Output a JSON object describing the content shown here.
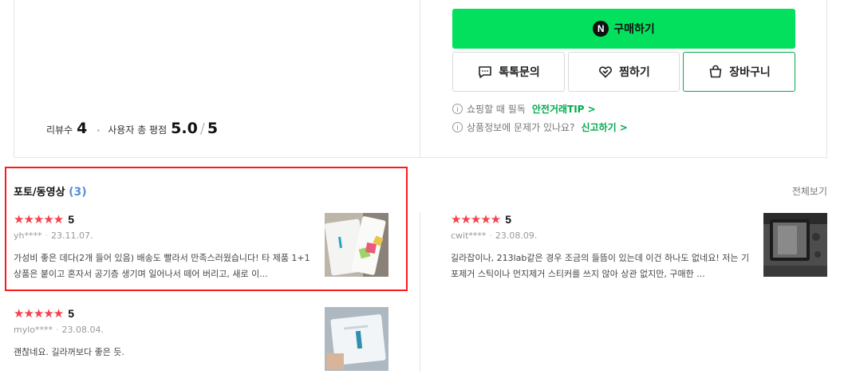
{
  "summary": {
    "review_count_label": "리뷰수",
    "review_count": "4",
    "avg_label": "사용자 총 평점",
    "avg_score": "5.0",
    "max_score": "5"
  },
  "actions": {
    "buy_label": "구매하기",
    "buy_badge": "N",
    "talk_label": "톡톡문의",
    "wish_label": "찜하기",
    "cart_label": "장바구니",
    "buy_color": "#03e05d"
  },
  "info": {
    "line1_text": "쇼핑할 때 필독",
    "line1_link": "안전거래TIP >",
    "line2_text": "상품정보에 문제가 있나요?",
    "line2_link": "신고하기 >",
    "icon": "i"
  },
  "reviews_section": {
    "title": "포토/동영상",
    "count": "(3)",
    "view_all": "전체보기"
  },
  "reviews": [
    {
      "stars": "★★★★★",
      "score": "5",
      "user": "yh****",
      "date": "23.11.07.",
      "text": "가성비 좋은 데다(2개 들어 있음) 배송도 빨라서 만족스러웠습니다! 타 제품 1+1 상품은 붙이고 혼자서 공기층 생기며 일어나서 떼어 버리고, 새로 이..."
    },
    {
      "stars": "★★★★★",
      "score": "5",
      "user": "cwit****",
      "date": "23.08.09.",
      "text": "길라잡이나, 213lab같은 경우 조금의 들뜸이 있는데 이건 하나도 없네요! 저는 기포제거 스틱이나 먼지제거 스티커를 쓰지 않아 상관 없지만, 구매한 ..."
    },
    {
      "stars": "★★★★★",
      "score": "5",
      "user": "mylo****",
      "date": "23.08.04.",
      "text": "괜찮네요. 길라꺼보다 좋은 듯."
    }
  ],
  "colors": {
    "star": "#f5414d",
    "link_green": "#03a94d",
    "count_blue": "#5b8fd6",
    "highlight": "#ff1a1a"
  }
}
